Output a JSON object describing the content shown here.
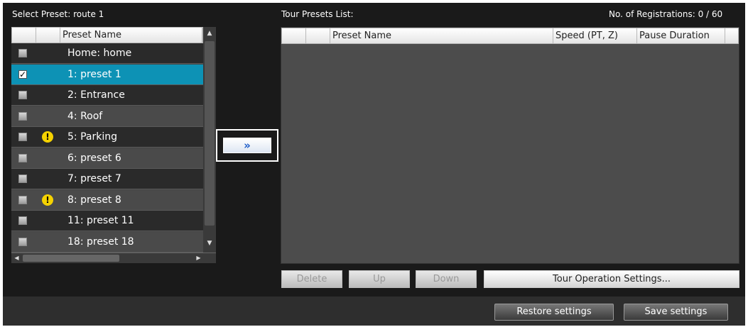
{
  "left": {
    "label_prefix": "Select Preset:",
    "route": "route 1",
    "table": {
      "column_name": "Preset Name",
      "rows": [
        {
          "label": "Home: home",
          "checked": false,
          "warning": false
        },
        {
          "label": "1: preset 1",
          "checked": true,
          "warning": false,
          "selected": true
        },
        {
          "label": "2: Entrance",
          "checked": false,
          "warning": false
        },
        {
          "label": "4: Roof",
          "checked": false,
          "warning": false
        },
        {
          "label": "5: Parking",
          "checked": false,
          "warning": true
        },
        {
          "label": "6: preset 6",
          "checked": false,
          "warning": false
        },
        {
          "label": "7: preset 7",
          "checked": false,
          "warning": false
        },
        {
          "label": "8: preset 8",
          "checked": false,
          "warning": true
        },
        {
          "label": "11: preset 11",
          "checked": false,
          "warning": false
        },
        {
          "label": "18: preset 18",
          "checked": false,
          "warning": false
        }
      ]
    }
  },
  "add_button": {
    "glyph": "»"
  },
  "right": {
    "title": "Tour Presets List:",
    "registrations": "No. of Registrations: 0 / 60",
    "columns": [
      "Preset Name",
      "Speed (PT, Z)",
      "Pause Duration"
    ]
  },
  "actions": {
    "delete": "Delete",
    "up": "Up",
    "down": "Down",
    "tour_settings": "Tour Operation Settings..."
  },
  "footer": {
    "restore": "Restore settings",
    "save": "Save settings"
  },
  "icons": {
    "checkbox": "checkbox-icon",
    "warning": "warning-icon",
    "add": "double-chevron-right-icon",
    "scroll_up": "arrow-up-icon",
    "scroll_down": "arrow-down-icon",
    "scroll_left": "arrow-left-icon",
    "scroll_right": "arrow-right-icon"
  },
  "colors": {
    "panel_bg": "#1a1a1a",
    "selected_row": "#0d92b5",
    "warning": "#f5d200",
    "add_icon": "#1a5ac8"
  }
}
